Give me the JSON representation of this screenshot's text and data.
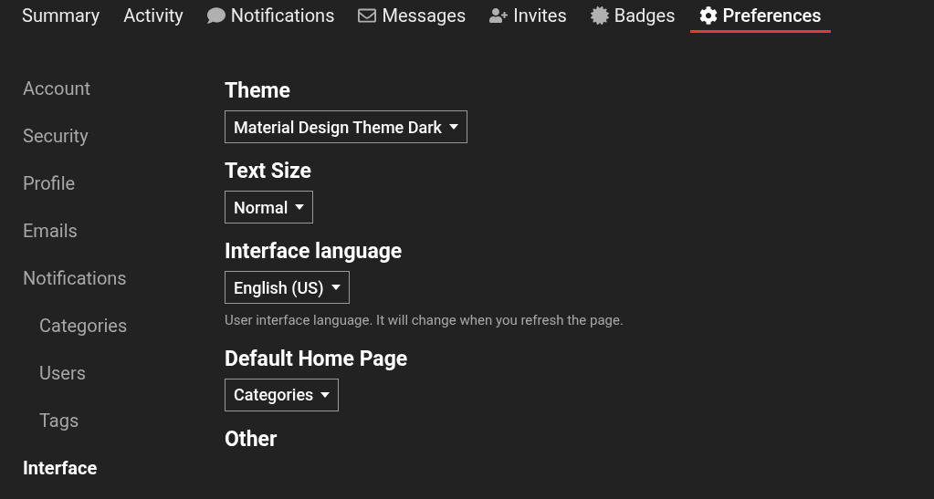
{
  "tabs": [
    {
      "label": "Summary",
      "selected": false
    },
    {
      "label": "Activity",
      "selected": false
    },
    {
      "label": "Notifications",
      "selected": false
    },
    {
      "label": "Messages",
      "selected": false
    },
    {
      "label": "Invites",
      "selected": false
    },
    {
      "label": "Badges",
      "selected": false
    },
    {
      "label": "Preferences",
      "selected": true
    }
  ],
  "sidebar": {
    "items": [
      {
        "label": "Account",
        "selected": false
      },
      {
        "label": "Security",
        "selected": false
      },
      {
        "label": "Profile",
        "selected": false
      },
      {
        "label": "Emails",
        "selected": false
      },
      {
        "label": "Notifications",
        "selected": false,
        "children": [
          {
            "label": "Categories",
            "selected": false
          },
          {
            "label": "Users",
            "selected": false
          },
          {
            "label": "Tags",
            "selected": false
          }
        ]
      },
      {
        "label": "Interface",
        "selected": true
      }
    ]
  },
  "sections": [
    {
      "heading": "Theme",
      "value": "Material Design Theme Dark"
    },
    {
      "heading": "Text Size",
      "value": "Normal"
    },
    {
      "heading": "Interface language",
      "value": "English (US)",
      "description": "User interface language. It will change when you refresh the page."
    },
    {
      "heading": "Default Home Page",
      "value": "Categories"
    },
    {
      "heading": "Other"
    }
  ]
}
